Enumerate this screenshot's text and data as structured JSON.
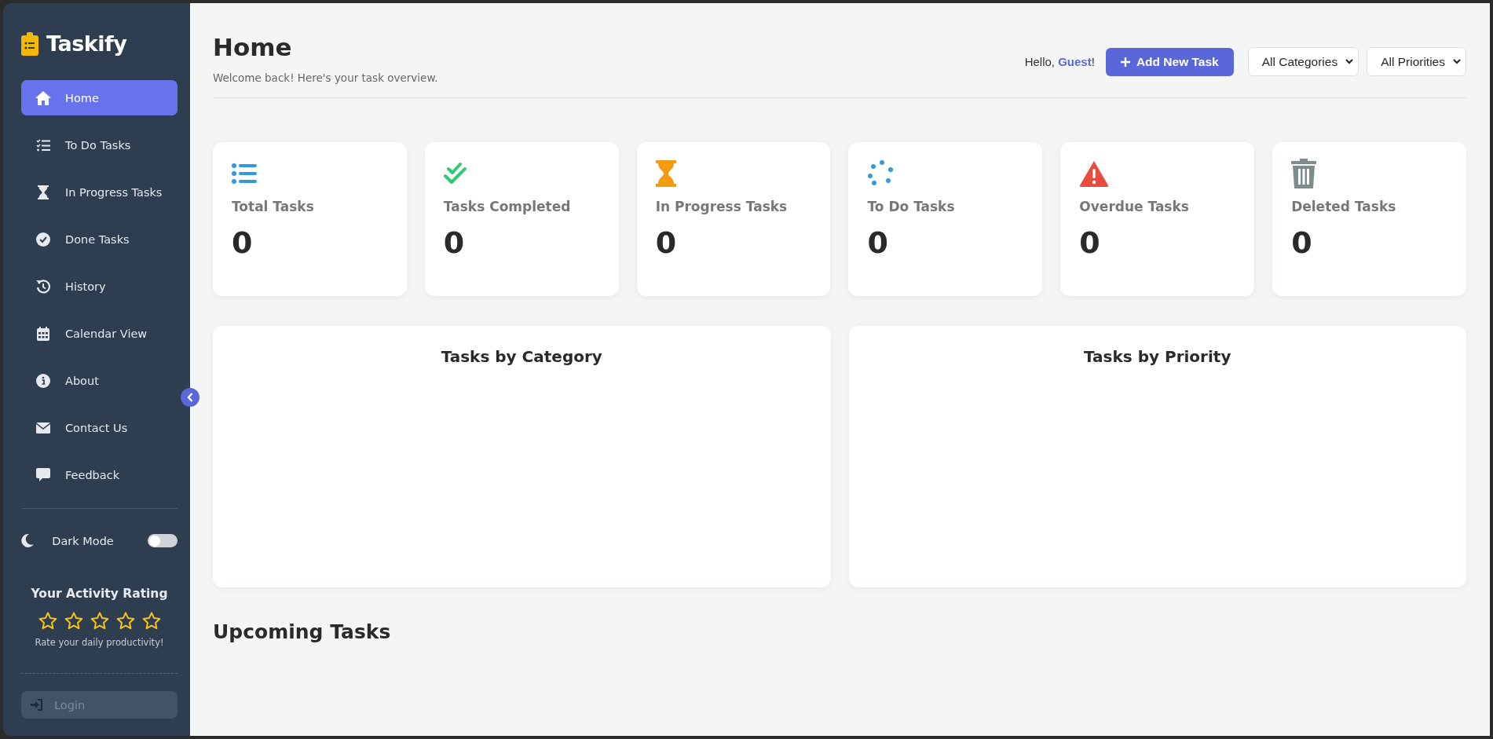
{
  "sidebar": {
    "brand": "Taskify",
    "items": [
      {
        "label": "Home",
        "kind": "home",
        "selected": true
      },
      {
        "label": "To Do Tasks",
        "kind": "checklist",
        "selected": false
      },
      {
        "label": "In Progress Tasks",
        "kind": "hourglass",
        "selected": false
      },
      {
        "label": "Done Tasks",
        "kind": "check-circle",
        "selected": false
      },
      {
        "label": "History",
        "kind": "history",
        "selected": false
      },
      {
        "label": "Calendar View",
        "kind": "calendar",
        "selected": false
      },
      {
        "label": "About",
        "kind": "info",
        "selected": false
      },
      {
        "label": "Contact Us",
        "kind": "envelope",
        "selected": false
      },
      {
        "label": "Feedback",
        "kind": "comment",
        "selected": false
      }
    ],
    "dark_mode": {
      "label": "Dark Mode",
      "on": false
    },
    "rating": {
      "title": "Your Activity Rating",
      "stars": 0,
      "caption": "Rate your daily productivity!"
    },
    "login": {
      "label": "Login"
    }
  },
  "header": {
    "title": "Home",
    "subtitle": "Welcome back! Here's your task overview.",
    "greeting": "Hello, ",
    "user": "Guest",
    "greeting_end": "!",
    "add_button": "Add New Task",
    "category_filter": "All Categories",
    "priority_filter": "All Priorities"
  },
  "stats": [
    {
      "label": "Total Tasks",
      "value": "0",
      "kind": "list",
      "color": "#3498db"
    },
    {
      "label": "Tasks Completed",
      "value": "0",
      "kind": "double-check",
      "color": "#2ecc71"
    },
    {
      "label": "In Progress Tasks",
      "value": "0",
      "kind": "hourglass",
      "color": "#f39c12"
    },
    {
      "label": "To Do Tasks",
      "value": "0",
      "kind": "spinner",
      "color": "#3498db"
    },
    {
      "label": "Overdue Tasks",
      "value": "0",
      "kind": "warning",
      "color": "#e74c3c"
    },
    {
      "label": "Deleted Tasks",
      "value": "0",
      "kind": "trash",
      "color": "#7f8c8d"
    }
  ],
  "charts": [
    {
      "title": "Tasks by Category"
    },
    {
      "title": "Tasks by Priority"
    }
  ],
  "upcoming": {
    "title": "Upcoming Tasks"
  }
}
